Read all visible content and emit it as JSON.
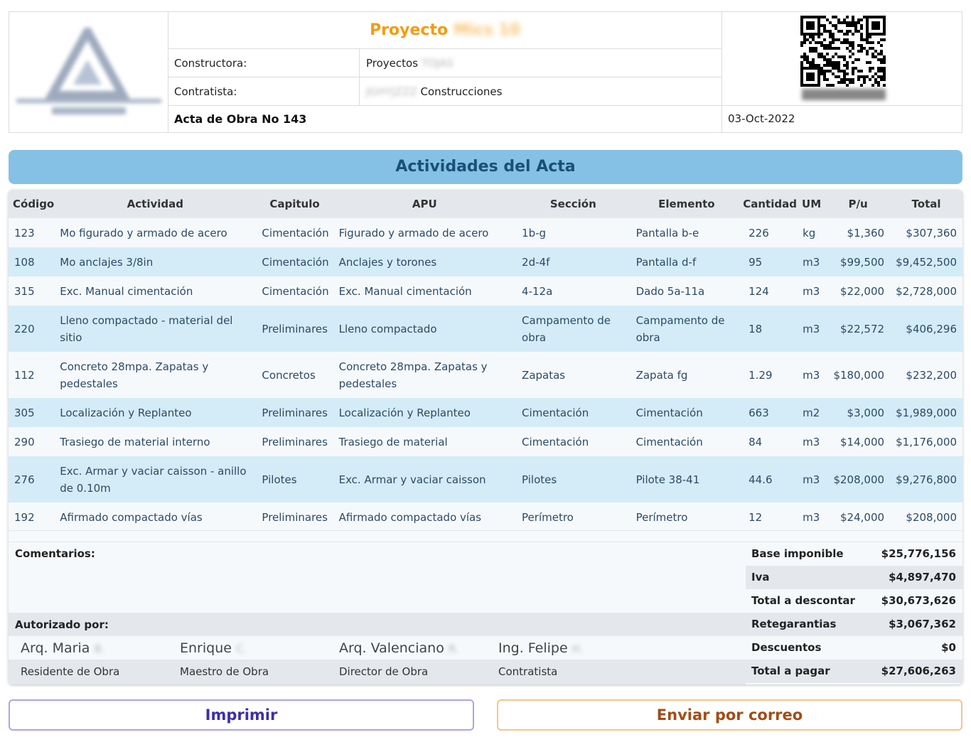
{
  "header": {
    "project_label": "Proyecto",
    "project_name_redacted": "Mics 10",
    "constructora_label": "Constructora:",
    "constructora_value": "Proyectos",
    "constructora_redacted": "TOJAS",
    "contratista_label": "Contratista:",
    "contratista_redacted": "JGHYJZZZ",
    "contratista_value": "Construcciones",
    "acta_title": "Acta de Obra No 143",
    "date": "03-Oct-2022"
  },
  "section_title": "Actividades del Acta",
  "table": {
    "columns": [
      "Código",
      "Actividad",
      "Capitulo",
      "APU",
      "Sección",
      "Elemento",
      "Cantidad",
      "UM",
      "P/u",
      "Total"
    ],
    "rows": [
      {
        "code": "123",
        "activity": "Mo figurado y armado de acero",
        "chapter": "Cimentación",
        "apu": "Figurado y armado de acero",
        "section": "1b-g",
        "element": "Pantalla b-e",
        "qty": "226",
        "um": "kg",
        "pu": "$1,360",
        "total": "$307,360"
      },
      {
        "code": "108",
        "activity": "Mo anclajes 3/8in",
        "chapter": "Cimentación",
        "apu": "Anclajes y torones",
        "section": "2d-4f",
        "element": "Pantalla d-f",
        "qty": "95",
        "um": "m3",
        "pu": "$99,500",
        "total": "$9,452,500"
      },
      {
        "code": "315",
        "activity": "Exc. Manual cimentación",
        "chapter": "Cimentación",
        "apu": "Exc. Manual cimentación",
        "section": "4-12a",
        "element": "Dado 5a-11a",
        "qty": "124",
        "um": "m3",
        "pu": "$22,000",
        "total": "$2,728,000"
      },
      {
        "code": "220",
        "activity": "Lleno compactado - material del sitio",
        "chapter": "Preliminares",
        "apu": "Lleno compactado",
        "section": "Campamento de obra",
        "element": "Campamento de obra",
        "qty": "18",
        "um": "m3",
        "pu": "$22,572",
        "total": "$406,296"
      },
      {
        "code": "112",
        "activity": "Concreto 28mpa. Zapatas y pedestales",
        "chapter": "Concretos",
        "apu": "Concreto 28mpa. Zapatas y pedestales",
        "section": "Zapatas",
        "element": "Zapata fg",
        "qty": "1.29",
        "um": "m3",
        "pu": "$180,000",
        "total": "$232,200"
      },
      {
        "code": "305",
        "activity": "Localización y Replanteo",
        "chapter": "Preliminares",
        "apu": "Localización y Replanteo",
        "section": "Cimentación",
        "element": "Cimentación",
        "qty": "663",
        "um": "m2",
        "pu": "$3,000",
        "total": "$1,989,000"
      },
      {
        "code": "290",
        "activity": "Trasiego de material interno",
        "chapter": "Preliminares",
        "apu": "Trasiego de material",
        "section": "Cimentación",
        "element": "Cimentación",
        "qty": "84",
        "um": "m3",
        "pu": "$14,000",
        "total": "$1,176,000"
      },
      {
        "code": "276",
        "activity": "Exc. Armar y vaciar caisson - anillo de 0.10m",
        "chapter": "Pilotes",
        "apu": "Exc. Armar y vaciar caisson",
        "section": "Pilotes",
        "element": "Pilote 38-41",
        "qty": "44.6",
        "um": "m3",
        "pu": "$208,000",
        "total": "$9,276,800"
      },
      {
        "code": "192",
        "activity": "Afirmado compactado vías",
        "chapter": "Preliminares",
        "apu": "Afirmado compactado vías",
        "section": "Perímetro",
        "element": "Perímetro",
        "qty": "12",
        "um": "m3",
        "pu": "$24,000",
        "total": "$208,000"
      }
    ]
  },
  "footer": {
    "comments_label": "Comentarios:",
    "authorized_label": "Autorizado por:",
    "signers": [
      {
        "name": "Arq. Maria",
        "redacted": "B.",
        "role": "Residente de Obra"
      },
      {
        "name": "Enrique",
        "redacted": "C.",
        "role": "Maestro de Obra"
      },
      {
        "name": "Arq. Valenciano",
        "redacted": "R.",
        "role": "Director de Obra"
      },
      {
        "name": "Ing. Felipe",
        "redacted": "H.",
        "role": "Contratista"
      }
    ],
    "totals": [
      {
        "label": "Base imponible",
        "value": "$25,776,156"
      },
      {
        "label": "Iva",
        "value": "$4,897,470"
      },
      {
        "label": "Total a descontar",
        "value": "$30,673,626"
      },
      {
        "label": "Retegarantias",
        "value": "$3,067,362"
      },
      {
        "label": "Descuentos",
        "value": "$0"
      },
      {
        "label": "Total a pagar",
        "value": "$27,606,263"
      }
    ]
  },
  "buttons": {
    "print": "Imprimir",
    "email": "Enviar por correo"
  },
  "colors": {
    "project_title": "#f39c12",
    "banner_bg": "#85c1e4",
    "banner_text": "#1a4f78",
    "row_alt": "#d4ecf7",
    "print_button": "#3b2fa8",
    "email_button": "#a14d16"
  }
}
